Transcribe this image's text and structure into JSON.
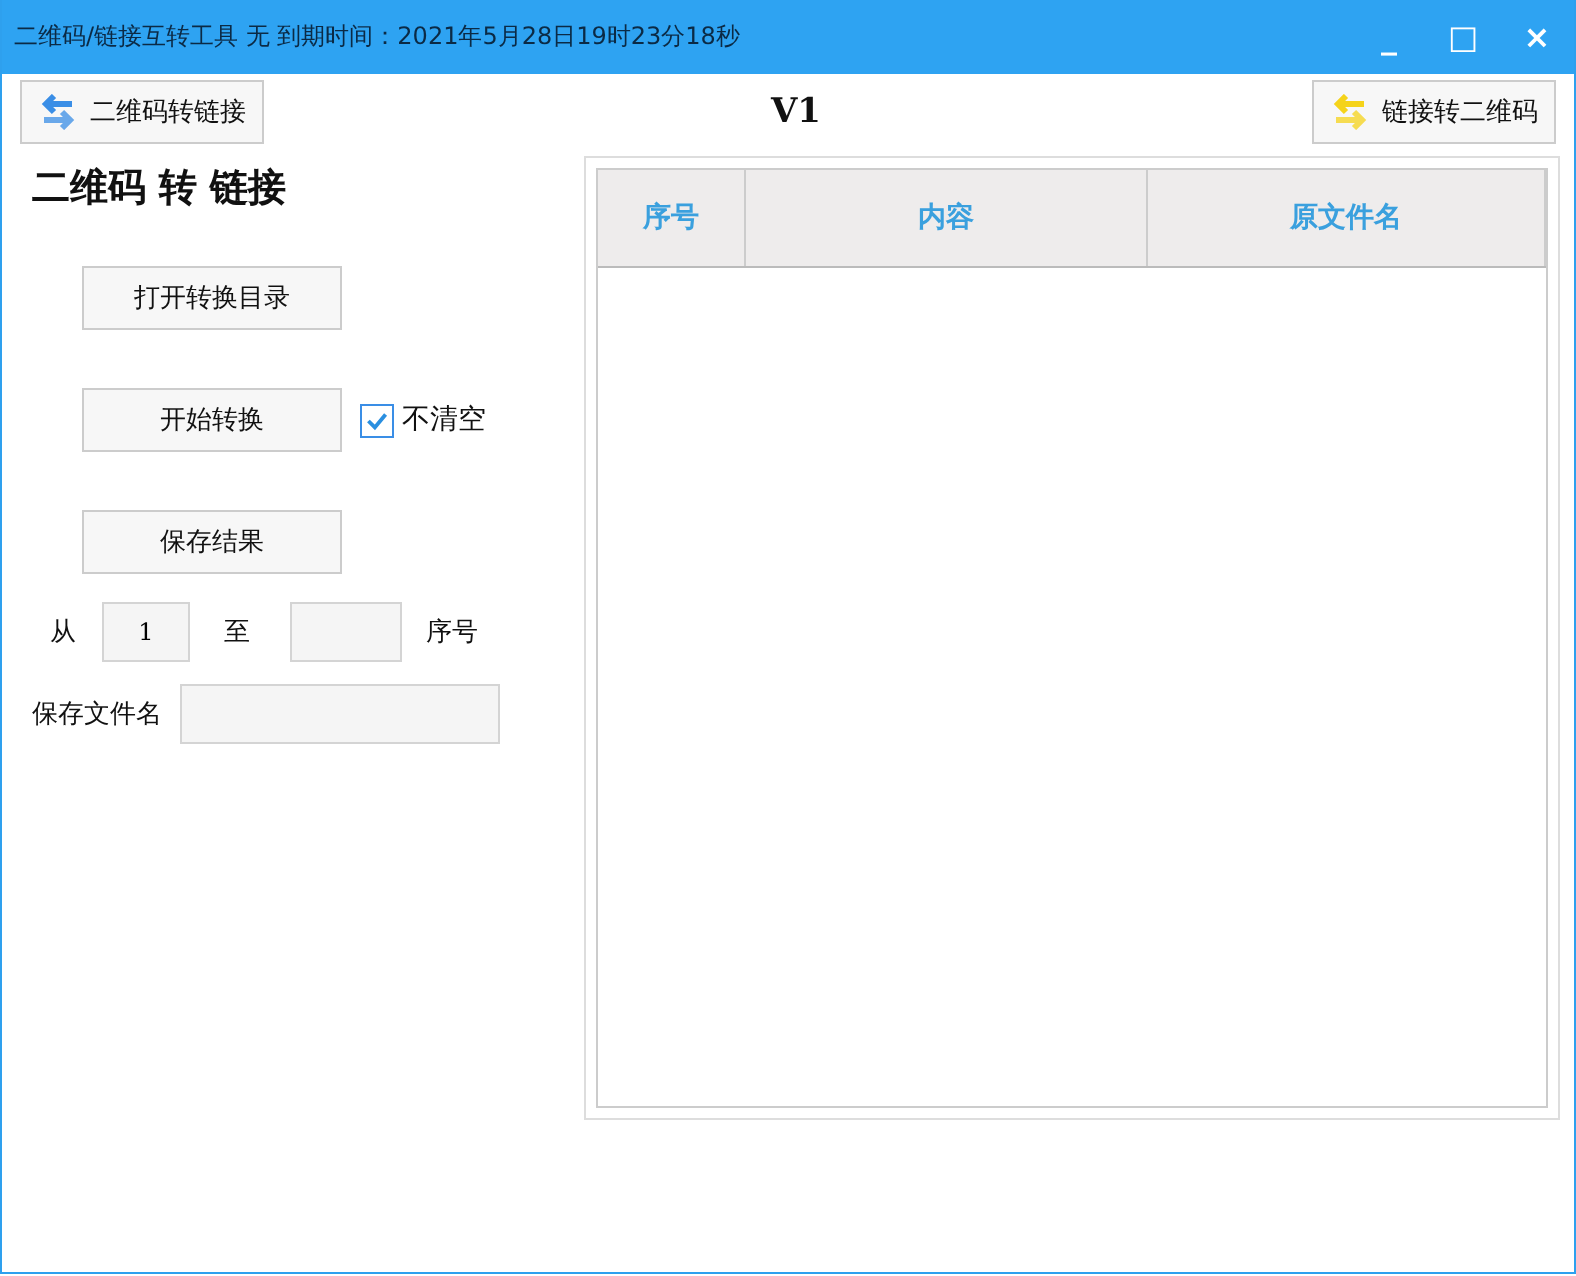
{
  "window": {
    "title": "二维码/链接互转工具 无 到期时间：2021年5月28日19时23分18秒",
    "controls": [
      "_",
      "□",
      "×"
    ]
  },
  "toolbar": {
    "left_button": "二维码转链接",
    "version": "V1",
    "right_button": "链接转二维码"
  },
  "heading": "二维码 转 链接",
  "actions": [
    {
      "label": "打开转换目录"
    },
    {
      "label": "开始转换",
      "checkbox": {
        "label": "不清空",
        "checked": true
      }
    },
    {
      "label": "保存结果"
    }
  ],
  "range": {
    "from_label": "从",
    "from_value": "1",
    "to_label": "至",
    "unit_label": "序号"
  },
  "save_name": {
    "label": "保存文件名"
  },
  "table": {
    "columns": [
      "序号",
      "内容",
      "原文件名"
    ]
  }
}
